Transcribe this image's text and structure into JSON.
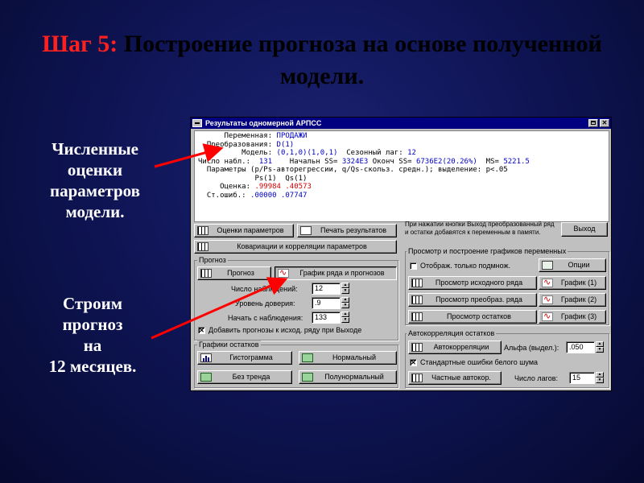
{
  "slide": {
    "title_step": "Шаг 5:",
    "title_rest": " Построение прогноза на основе полученной модели.",
    "note_left_top": [
      "Численные",
      "оценки",
      "параметров",
      "модели."
    ],
    "note_left_bottom": [
      "Строим",
      "прогноз",
      "на",
      "12 месяцев."
    ],
    "arrow_color": "#ff0000"
  },
  "window": {
    "title": "Результаты одномерной АРПСС",
    "output_lines": [
      {
        "label": "      Переменная: ",
        "value": "ПРОДАЖИ"
      },
      {
        "label": "  Преобразования: ",
        "value": "D(1)"
      },
      {
        "label": "          Модель: ",
        "value": "(0,1,0)(1,0,1)",
        "extra_label": "  Сезонный лаг: ",
        "extra_value": "12"
      },
      {
        "label": "Число набл.:  ",
        "value": "131",
        "extra_label": "    Начальн SS= ",
        "extra_value": "3324E3",
        "label3": " Оконч SS= ",
        "value3": "6736E2(20.26%)",
        "label4": "  MS= ",
        "value4": "5221.5"
      },
      {
        "label": "  Параметры (p/Ps-авторегрессии, q/Qs-скольз. средн.); выделение: p<.05",
        "value": ""
      },
      {
        "label": "             Ps(1)  Qs(1)",
        "value": ""
      },
      {
        "label": "     Оценка: ",
        "value": ".99984",
        "extra_label": " ",
        "extra_value": ".40573"
      },
      {
        "label": "  Ст.ошиб.: ",
        "value": ".00000",
        "extra_label": " ",
        "extra_value": ".07747"
      }
    ],
    "buttons": {
      "param_estimates": "Оценки параметров",
      "print_results": "Печать результатов",
      "exit": "Выход",
      "covariance": "Ковариации и корреляции параметров",
      "forecast": "Прогноз",
      "series_forecast_plot": "График ряда и прогнозов",
      "options": "Опции",
      "view_original": "Просмотр исходного ряда",
      "view_transformed": "Просмотр преобраз. ряда",
      "view_residuals": "Просмотр остатков",
      "plot_1": "График (1)",
      "plot_2": "График (2)",
      "plot_3": "График (3)",
      "histogram": "Гистограмма",
      "normal": "Нормальный",
      "detrended": "Без тренда",
      "half_normal": "Полунормальный",
      "autocorr": "Автокорреляции",
      "partial_autocorr": "Частные автокор."
    },
    "exit_note": "При нажатии кнопки Выход преобразованный ряд и остатки добавятся к переменным в памяти.",
    "groups": {
      "forecast": "Прогноз",
      "residual_plots": "Графики остатков",
      "view_plots": "Просмотр и построение графиков переменных",
      "residual_acf": "Автокорреляция остатков"
    },
    "fields": {
      "n_obs_label": "Число наблюдений:",
      "n_obs_value": "12",
      "confidence_label": "Уровень доверия:",
      "confidence_value": ".9",
      "start_label": "Начать с наблюдения:",
      "start_value": "133",
      "append_forecast_label": "Добавить прогнозы к исход. ряду при Выходе",
      "append_forecast_checked": true,
      "show_subset_label": "Отображ. только подмнож.",
      "show_subset_checked": false,
      "alpha_label": "Альфа (выдел.):",
      "alpha_value": ".050",
      "white_noise_label": "Стандартные ошибки белого шума",
      "white_noise_checked": true,
      "lags_label": "Число лагов:",
      "lags_value": "15"
    }
  }
}
